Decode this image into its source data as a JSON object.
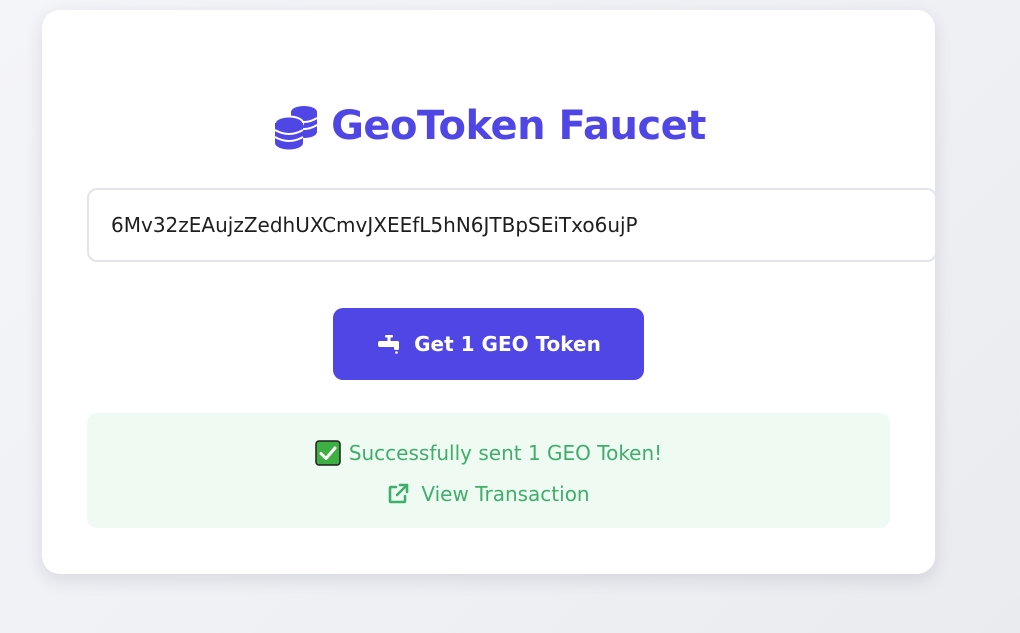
{
  "page": {
    "title": "GeoToken Faucet",
    "title_icon": "coins-icon"
  },
  "form": {
    "address_value": "6Mv32zEAujzZedhUXCmvJXEEfL5hN6JTBpSEiTxo6ujP",
    "button_label": "Get 1 GEO Token",
    "button_icon": "faucet-icon"
  },
  "result": {
    "status_icon": "check-icon",
    "message": "Successfully sent 1 GEO Token!",
    "link_label": "View Transaction",
    "link_icon": "external-link-icon"
  },
  "colors": {
    "accent": "#4f46e5",
    "success_text": "#3fae6b",
    "success_bg": "#effaf3",
    "check_green": "#3cb043"
  }
}
